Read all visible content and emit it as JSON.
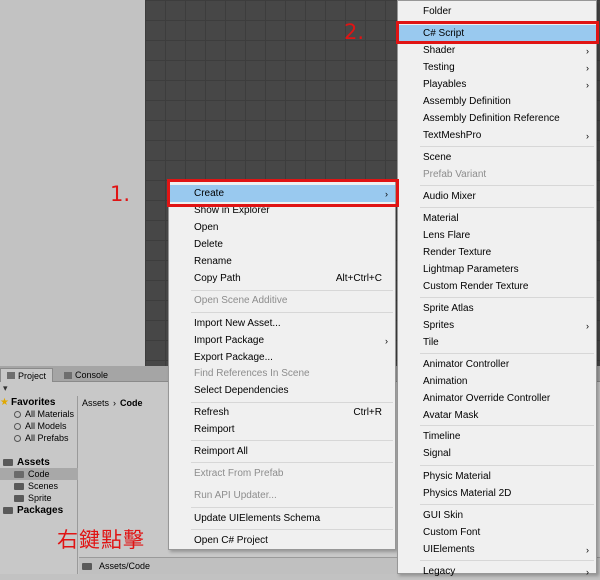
{
  "annotations": {
    "step1": "1.",
    "step2": "2.",
    "right_click_text": "右鍵點擊"
  },
  "colors": {
    "highlight": "#99c9ef",
    "annotation_red": "#e01414",
    "menu_bg": "#f0f0f0"
  },
  "project_panel": {
    "tabs": [
      {
        "label": "Project",
        "icon": "project-icon"
      },
      {
        "label": "Console",
        "icon": "console-icon"
      }
    ],
    "toolbar_label": "▾",
    "tree": {
      "favorites": "Favorites",
      "favorites_items": [
        "All Materials",
        "All Models",
        "All Prefabs"
      ],
      "assets": "Assets",
      "assets_children": [
        "Code",
        "Scenes",
        "Sprite"
      ],
      "packages": "Packages"
    },
    "breadcrumb": [
      "Assets",
      "Code"
    ],
    "bottom_path": "Assets/Code"
  },
  "context_menu": {
    "items": [
      {
        "label": "Create",
        "arrow": "›",
        "shortcut": ""
      },
      {
        "label": "Show in Explorer",
        "shortcut": ""
      },
      {
        "label": "Open",
        "shortcut": ""
      },
      {
        "label": "Delete",
        "shortcut": ""
      },
      {
        "label": "Rename",
        "shortcut": ""
      },
      {
        "label": "Copy Path",
        "shortcut": "Alt+Ctrl+C"
      },
      {
        "label": "Open Scene Additive",
        "shortcut": ""
      },
      {
        "label": "Import New Asset...",
        "shortcut": ""
      },
      {
        "label": "Import Package",
        "arrow": "›",
        "shortcut": ""
      },
      {
        "label": "Export Package...",
        "shortcut": ""
      },
      {
        "label": "Find References In Scene",
        "shortcut": ""
      },
      {
        "label": "Select Dependencies",
        "shortcut": ""
      },
      {
        "label": "Refresh",
        "shortcut": "Ctrl+R"
      },
      {
        "label": "Reimport",
        "shortcut": ""
      },
      {
        "label": "Reimport All",
        "shortcut": ""
      },
      {
        "label": "Extract From Prefab",
        "shortcut": ""
      },
      {
        "label": "Run API Updater...",
        "shortcut": ""
      },
      {
        "label": "Update UIElements Schema",
        "shortcut": ""
      },
      {
        "label": "Open C# Project",
        "shortcut": ""
      }
    ]
  },
  "create_submenu": {
    "items": [
      {
        "label": "Folder"
      },
      {
        "label": "C# Script"
      },
      {
        "label": "Shader",
        "arrow": "›"
      },
      {
        "label": "Testing",
        "arrow": "›"
      },
      {
        "label": "Playables",
        "arrow": "›"
      },
      {
        "label": "Assembly Definition"
      },
      {
        "label": "Assembly Definition Reference"
      },
      {
        "label": "TextMeshPro",
        "arrow": "›"
      },
      {
        "label": "Scene"
      },
      {
        "label": "Prefab Variant"
      },
      {
        "label": "Audio Mixer"
      },
      {
        "label": "Material"
      },
      {
        "label": "Lens Flare"
      },
      {
        "label": "Render Texture"
      },
      {
        "label": "Lightmap Parameters"
      },
      {
        "label": "Custom Render Texture"
      },
      {
        "label": "Sprite Atlas"
      },
      {
        "label": "Sprites",
        "arrow": "›"
      },
      {
        "label": "Tile"
      },
      {
        "label": "Animator Controller"
      },
      {
        "label": "Animation"
      },
      {
        "label": "Animator Override Controller"
      },
      {
        "label": "Avatar Mask"
      },
      {
        "label": "Timeline"
      },
      {
        "label": "Signal"
      },
      {
        "label": "Physic Material"
      },
      {
        "label": "Physics Material 2D"
      },
      {
        "label": "GUI Skin"
      },
      {
        "label": "Custom Font"
      },
      {
        "label": "UIElements",
        "arrow": "›"
      },
      {
        "label": "Legacy",
        "arrow": "›"
      }
    ]
  }
}
